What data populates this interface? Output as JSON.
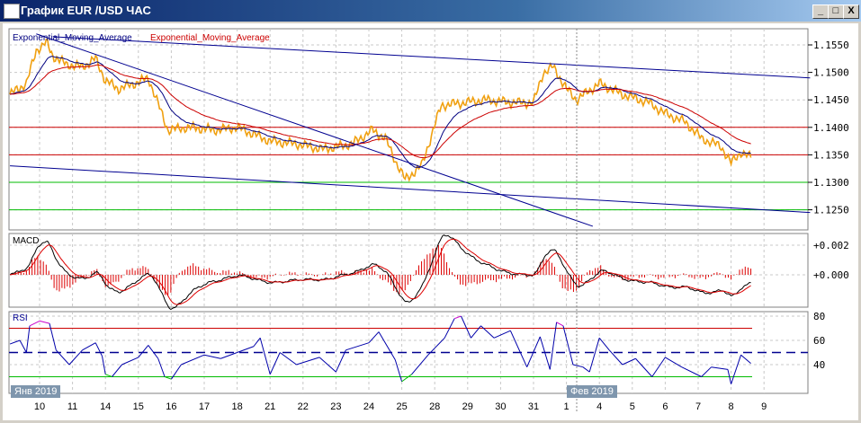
{
  "window": {
    "title": "График EUR /USD  ЧАС",
    "buttons": {
      "minimize": "_",
      "maximize": "□",
      "close": "X"
    }
  },
  "colors": {
    "price": "#f0a010",
    "ema_fast": "#000080",
    "ema_slow": "#cc0000",
    "trend": "#000090",
    "resistance": "#cc0000",
    "support": "#00bb00",
    "rsi_normal": "#0000aa",
    "rsi_overbought": "#cc00cc",
    "rsi_oversold": "#00bb00"
  },
  "chart_data": [
    {
      "type": "line",
      "title": "Price",
      "legend": [
        "Exponential_Moving_Average",
        "Exponential_Moving_Average"
      ],
      "y_ticks": [
        "1.1550",
        "1.1500",
        "1.1450",
        "1.1400",
        "1.1350",
        "1.1300",
        "1.1250"
      ],
      "ylim": [
        1.1225,
        1.158
      ],
      "x_categories": [
        "10",
        "11",
        "14",
        "15",
        "16",
        "17",
        "18",
        "21",
        "22",
        "23",
        "24",
        "25",
        "28",
        "29",
        "30",
        "31",
        "1",
        "4",
        "5",
        "6",
        "7",
        "8",
        "9"
      ],
      "price": [
        [
          -0.9,
          1.146
        ],
        [
          -0.4,
          1.148
        ],
        [
          -0.1,
          1.154
        ],
        [
          0.2,
          1.1555
        ],
        [
          0.4,
          1.153
        ],
        [
          0.8,
          1.1515
        ],
        [
          1.3,
          1.151
        ],
        [
          1.7,
          1.1525
        ],
        [
          2.0,
          1.1485
        ],
        [
          2.4,
          1.147
        ],
        [
          2.9,
          1.148
        ],
        [
          3.3,
          1.149
        ],
        [
          3.9,
          1.1395
        ],
        [
          4.5,
          1.14
        ],
        [
          5.4,
          1.1395
        ],
        [
          6.0,
          1.14
        ],
        [
          7.0,
          1.1375
        ],
        [
          7.8,
          1.137
        ],
        [
          8.6,
          1.136
        ],
        [
          9.5,
          1.137
        ],
        [
          10.1,
          1.1395
        ],
        [
          10.5,
          1.138
        ],
        [
          10.8,
          1.134
        ],
        [
          11.1,
          1.1305
        ],
        [
          11.6,
          1.133
        ],
        [
          12.2,
          1.144
        ],
        [
          12.9,
          1.1445
        ],
        [
          13.5,
          1.145
        ],
        [
          14.4,
          1.1445
        ],
        [
          15.0,
          1.1445
        ],
        [
          15.3,
          1.15
        ],
        [
          15.6,
          1.151
        ],
        [
          16.0,
          1.147
        ],
        [
          16.3,
          1.145
        ],
        [
          17.0,
          1.148
        ],
        [
          17.7,
          1.146
        ],
        [
          18.5,
          1.1445
        ],
        [
          19.0,
          1.1425
        ],
        [
          19.6,
          1.141
        ],
        [
          20.1,
          1.138
        ],
        [
          20.7,
          1.1365
        ],
        [
          21.0,
          1.1335
        ],
        [
          21.3,
          1.1355
        ],
        [
          21.6,
          1.1345
        ]
      ],
      "horizontal_levels": [
        {
          "price": 1.14,
          "kind": "resistance"
        },
        {
          "price": 1.135,
          "kind": "resistance"
        },
        {
          "price": 1.13,
          "kind": "support"
        },
        {
          "price": 1.125,
          "kind": "support"
        }
      ],
      "trendlines": [
        [
          [
            -0.1,
            1.157
          ],
          [
            16.8,
            1.122
          ]
        ],
        [
          [
            -0.9,
            1.133
          ],
          [
            23.4,
            1.1245
          ]
        ],
        [
          [
            0.4,
            1.1565
          ],
          [
            23.4,
            1.149
          ]
        ]
      ]
    },
    {
      "type": "line",
      "title": "MACD",
      "y_ticks": [
        "+0.002",
        "+0.000"
      ],
      "ylim": [
        -0.0022,
        0.0028
      ]
    },
    {
      "type": "line",
      "title": "RSI",
      "y_ticks": [
        "80",
        "60",
        "40"
      ],
      "ylim": [
        20,
        82
      ],
      "levels": [
        70,
        50,
        30
      ],
      "rsi": [
        [
          -0.9,
          57
        ],
        [
          -0.6,
          60
        ],
        [
          -0.4,
          50
        ],
        [
          -0.3,
          72
        ],
        [
          0,
          76
        ],
        [
          0.3,
          74
        ],
        [
          0.5,
          52
        ],
        [
          0.9,
          40
        ],
        [
          1.3,
          52
        ],
        [
          1.7,
          58
        ],
        [
          1.9,
          47
        ],
        [
          2.0,
          32
        ],
        [
          2.2,
          30
        ],
        [
          2.5,
          40
        ],
        [
          3.0,
          46
        ],
        [
          3.3,
          56
        ],
        [
          3.6,
          45
        ],
        [
          3.8,
          30
        ],
        [
          4.0,
          28
        ],
        [
          4.3,
          40
        ],
        [
          5.0,
          48
        ],
        [
          5.5,
          45
        ],
        [
          6.0,
          50
        ],
        [
          6.5,
          55
        ],
        [
          6.7,
          62
        ],
        [
          7.0,
          32
        ],
        [
          7.3,
          50
        ],
        [
          7.8,
          40
        ],
        [
          8.5,
          46
        ],
        [
          9.0,
          34
        ],
        [
          9.3,
          52
        ],
        [
          10.0,
          58
        ],
        [
          10.3,
          67
        ],
        [
          10.8,
          44
        ],
        [
          11.0,
          26
        ],
        [
          11.3,
          32
        ],
        [
          11.8,
          48
        ],
        [
          12.3,
          62
        ],
        [
          12.6,
          78
        ],
        [
          12.8,
          80
        ],
        [
          13.1,
          62
        ],
        [
          13.4,
          72
        ],
        [
          13.8,
          62
        ],
        [
          14.3,
          68
        ],
        [
          14.8,
          38
        ],
        [
          15.2,
          63
        ],
        [
          15.5,
          36
        ],
        [
          15.7,
          75
        ],
        [
          15.9,
          72
        ],
        [
          16.2,
          40
        ],
        [
          16.5,
          38
        ],
        [
          16.7,
          34
        ],
        [
          17.0,
          62
        ],
        [
          17.3,
          52
        ],
        [
          17.7,
          40
        ],
        [
          18.1,
          45
        ],
        [
          18.6,
          30
        ],
        [
          19.0,
          46
        ],
        [
          19.5,
          38
        ],
        [
          20.1,
          30
        ],
        [
          20.4,
          38
        ],
        [
          20.9,
          36
        ],
        [
          21.0,
          24
        ],
        [
          21.3,
          48
        ],
        [
          21.6,
          41
        ]
      ]
    }
  ],
  "month_markers": [
    "Янв 2019",
    "Фев 2019"
  ]
}
